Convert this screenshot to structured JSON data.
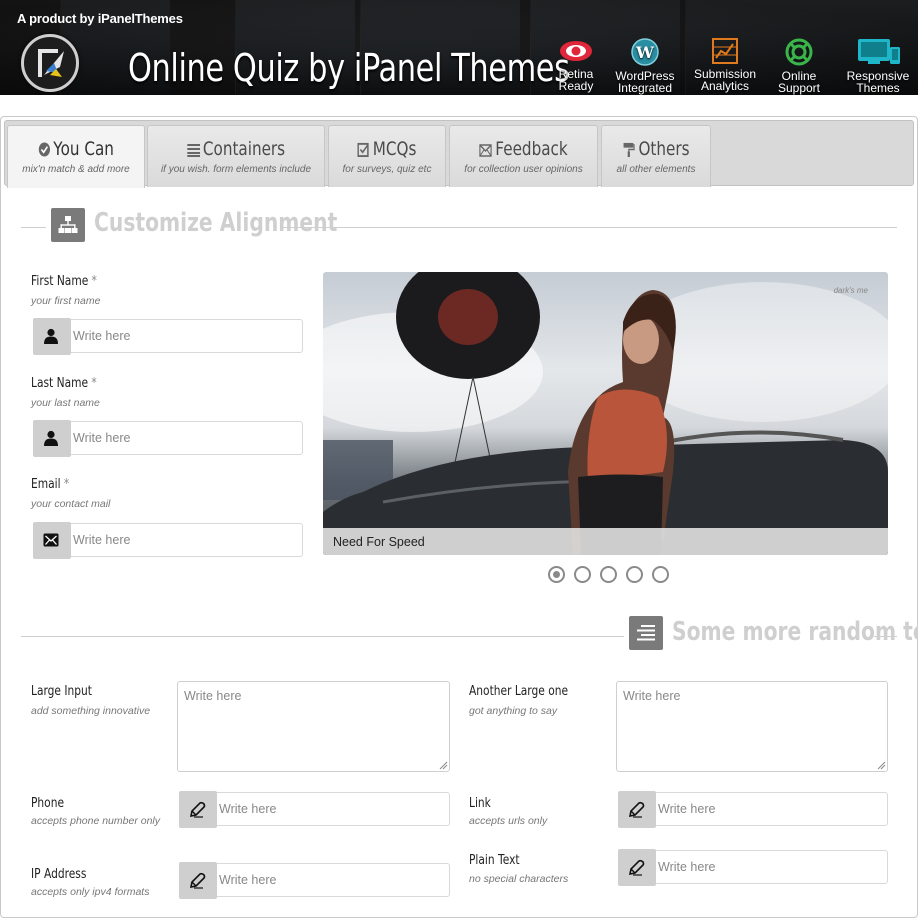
{
  "banner": {
    "byline": "A product by iPanelThemes",
    "title": "Online Quiz by iPanel Themes",
    "features": [
      {
        "line1": "Retina",
        "line2": "Ready",
        "icon": "eye-icon",
        "color": "#e0263a"
      },
      {
        "line1": "WordPress",
        "line2": "Integrated",
        "icon": "wordpress-icon",
        "color": "#3aa5b8"
      },
      {
        "line1": "Submission",
        "line2": "Analytics",
        "icon": "chart-icon",
        "color": "#e07a1e"
      },
      {
        "line1": "Online",
        "line2": "Support",
        "icon": "lifebuoy-icon",
        "color": "#39b54a"
      },
      {
        "line1": "Responsive",
        "line2": "Themes",
        "icon": "devices-icon",
        "color": "#1fb6c9"
      }
    ]
  },
  "tabs": [
    {
      "label": "You Can",
      "sub": "mix'n match & add more",
      "icon": "check-circle-icon",
      "active": true
    },
    {
      "label": "Containers",
      "sub": "if you wish. form elements include",
      "icon": "list-icon",
      "active": false
    },
    {
      "label": "MCQs",
      "sub": "for surveys, quiz etc",
      "icon": "checkbox-icon",
      "active": false
    },
    {
      "label": "Feedback",
      "sub": "for collection user opinions",
      "icon": "envelope-icon",
      "active": false
    },
    {
      "label": "Others",
      "sub": "all other elements",
      "icon": "paint-roller-icon",
      "active": false
    }
  ],
  "section1": {
    "title": "Customize Alignment",
    "icon": "sitemap-icon"
  },
  "section2": {
    "title": "Some more random texts",
    "icon": "align-icon"
  },
  "fields_left": [
    {
      "label": "First Name",
      "required": "*",
      "hint": "your first name",
      "placeholder": "Write here",
      "icon": "user-icon"
    },
    {
      "label": "Last Name",
      "required": "*",
      "hint": "your last name",
      "placeholder": "Write here",
      "icon": "user-icon"
    },
    {
      "label": "Email",
      "required": "*",
      "hint": "your contact mail",
      "placeholder": "Write here",
      "icon": "envelope-icon"
    }
  ],
  "slider": {
    "caption": "Need For Speed",
    "watermark": "dark's me",
    "slides": 5,
    "active_index": 0
  },
  "large_inputs": [
    {
      "label": "Large Input",
      "hint": "add something innovative",
      "placeholder": "Write here"
    },
    {
      "label": "Another Large one",
      "hint": "got anything to say",
      "placeholder": "Write here"
    }
  ],
  "small_inputs_left": [
    {
      "label": "Phone",
      "hint": "accepts phone number only",
      "placeholder": "Write here",
      "icon": "pencil-icon"
    },
    {
      "label": "IP Address",
      "hint": "accepts only ipv4 formats",
      "placeholder": "Write here",
      "icon": "pencil-icon"
    }
  ],
  "small_inputs_right": [
    {
      "label": "Link",
      "hint": "accepts urls only",
      "placeholder": "Write here",
      "icon": "pencil-icon"
    },
    {
      "label": "Plain Text",
      "hint": "no special characters",
      "placeholder": "Write here",
      "icon": "pencil-icon"
    }
  ]
}
